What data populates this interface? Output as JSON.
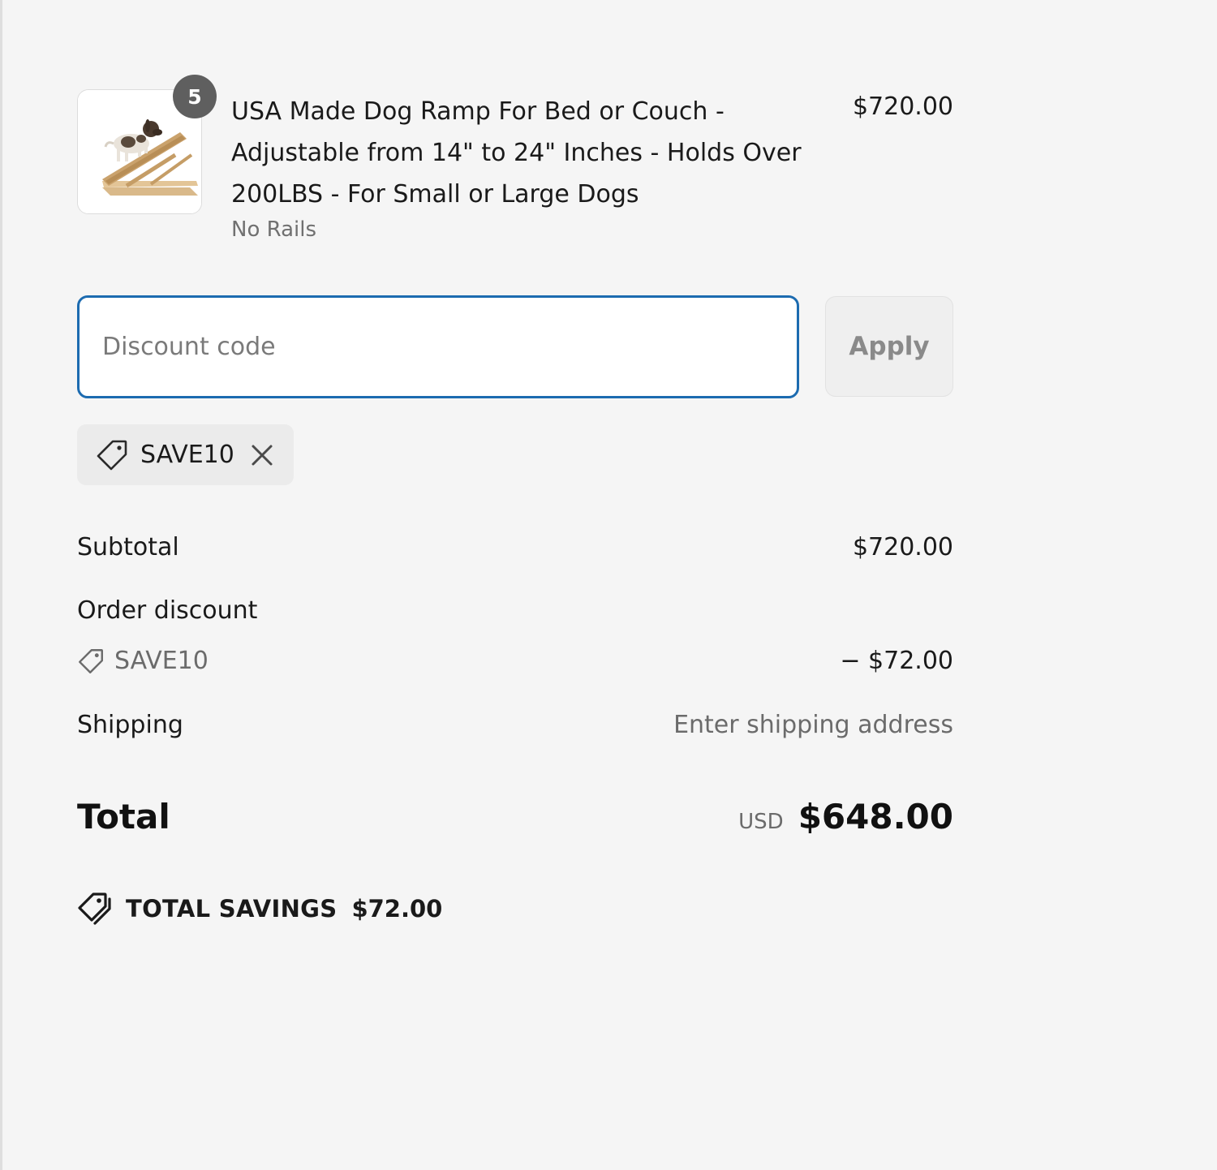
{
  "line_item": {
    "quantity": "5",
    "title": "USA Made Dog Ramp For Bed or Couch - Adjustable from 14\" to 24\" Inches - Holds Over 200LBS - For Small or Large Dogs",
    "variant": "No Rails",
    "price": "$720.00",
    "image_icon": "dog-ramp-product-image"
  },
  "discount": {
    "placeholder": "Discount code",
    "value": "",
    "apply_label": "Apply",
    "applied_code": "SAVE10"
  },
  "totals": {
    "subtotal_label": "Subtotal",
    "subtotal_value": "$720.00",
    "order_discount_label": "Order discount",
    "order_discount_code": "SAVE10",
    "order_discount_value": "− $72.00",
    "shipping_label": "Shipping",
    "shipping_value": "Enter shipping address",
    "total_label": "Total",
    "currency": "USD",
    "total_value": "$648.00",
    "savings_label": "TOTAL SAVINGS",
    "savings_value": "$72.00"
  },
  "colors": {
    "background": "#f5f5f5",
    "focus_border": "#1c6bb0",
    "badge": "#5f5f5f"
  }
}
